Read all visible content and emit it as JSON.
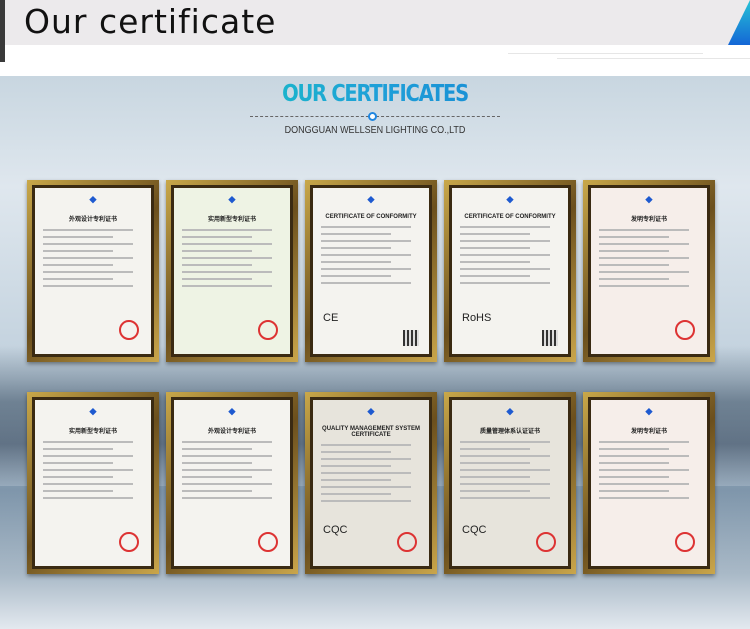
{
  "header": {
    "title": "Our certificate"
  },
  "section": {
    "title": "OUR CERTIFICATES",
    "subtitle": "DONGGUAN WELLSEN LIGHTING CO.,LTD",
    "accent": "#1f86e0"
  },
  "certificates": [
    {
      "title": "外观设计专利证书",
      "mark": "",
      "style": "white"
    },
    {
      "title": "实用新型专利证书",
      "mark": "",
      "style": "green"
    },
    {
      "title": "CERTIFICATE OF CONFORMITY",
      "mark": "CE",
      "style": "white"
    },
    {
      "title": "CERTIFICATE OF CONFORMITY",
      "mark": "RoHS",
      "style": "white"
    },
    {
      "title": "发明专利证书",
      "mark": "",
      "style": "pink"
    },
    {
      "title": "实用新型专利证书",
      "mark": "",
      "style": "white"
    },
    {
      "title": "外观设计专利证书",
      "mark": "",
      "style": "white"
    },
    {
      "title": "QUALITY MANAGEMENT SYSTEM CERTIFICATE",
      "mark": "CQC",
      "style": "gray"
    },
    {
      "title": "质量管理体系认证证书",
      "mark": "CQC",
      "style": "gray"
    },
    {
      "title": "发明专利证书",
      "mark": "",
      "style": "pink"
    }
  ]
}
